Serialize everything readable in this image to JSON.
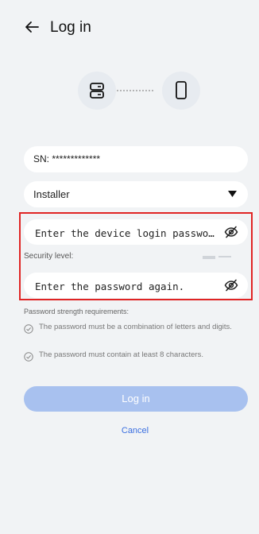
{
  "header": {
    "title": "Log in"
  },
  "icons": {
    "back": "arrow-left-icon",
    "device": "server-icon",
    "phone": "phone-icon",
    "connection": "dotted-line",
    "eye": "eye-off-icon",
    "check": "check-circle-icon",
    "dropdown": "triangle-down-icon"
  },
  "form": {
    "sn_text": "SN: *************",
    "role_value": "Installer",
    "password_placeholder": "Enter the device login passwo…",
    "security_level_label": "Security level:",
    "confirm_placeholder": "Enter the password again.",
    "requirements_title": "Password strength requirements:",
    "requirements": [
      "The password must be a combination of letters and digits.",
      "The password must contain at least 8 characters."
    ]
  },
  "actions": {
    "login_label": "Log in",
    "cancel_label": "Cancel"
  },
  "colors": {
    "background": "#f1f3f5",
    "accent": "#3b6fe0",
    "button_disabled": "#a8c1ef",
    "highlight_border": "#e02424"
  }
}
